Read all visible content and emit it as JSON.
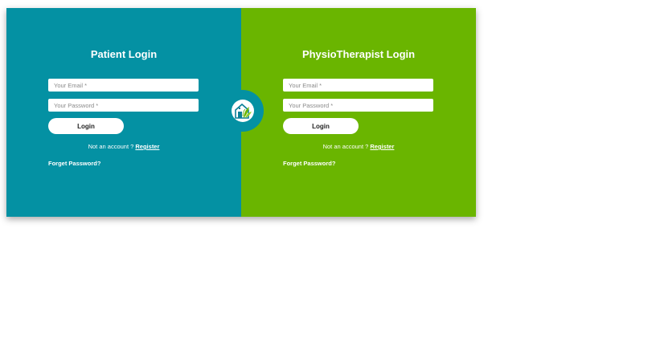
{
  "patient": {
    "title": "Patient Login",
    "email_placeholder": "Your Email *",
    "password_placeholder": "Your Password *",
    "login_label": "Login",
    "no_account_text": "Not an account ? ",
    "register_label": "Register",
    "forget_label": "Forget Password?"
  },
  "physio": {
    "title": "PhysioTherapist Login",
    "email_placeholder": "Your Email *",
    "password_placeholder": "Your Password *",
    "login_label": "Login",
    "no_account_text": "Not an account ? ",
    "register_label": "Register",
    "forget_label": "Forget Password?"
  },
  "logo": {
    "icon": "clinic-logo-icon"
  },
  "colors": {
    "patient_panel": "#0491a3",
    "physio_panel": "#6ab500",
    "text": "#ffffff"
  }
}
